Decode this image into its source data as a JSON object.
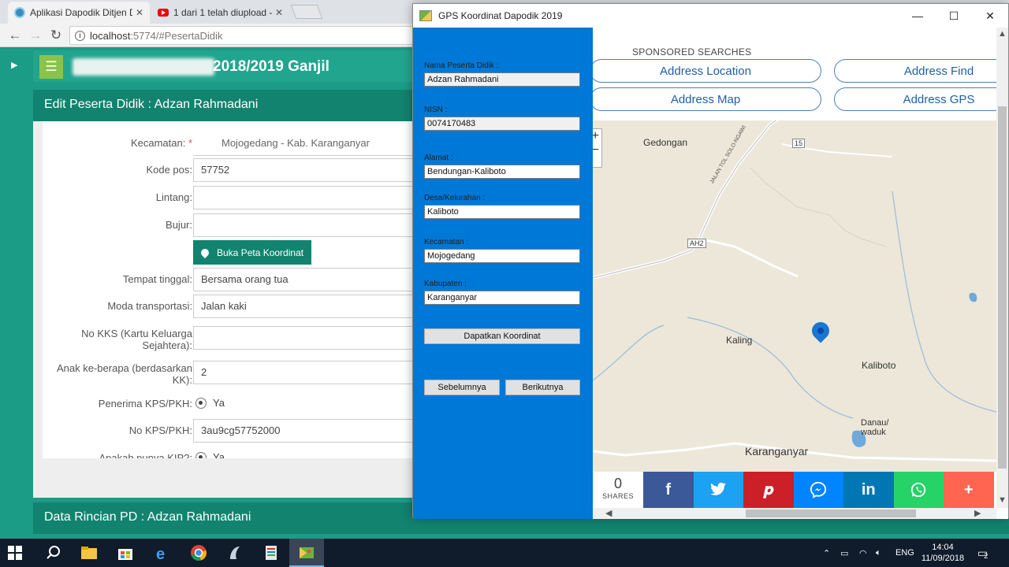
{
  "browser": {
    "tabs": [
      {
        "title": "Aplikasi Dapodik Ditjen D",
        "active": true
      },
      {
        "title": "1 dari 1 telah diupload - Y",
        "active": false
      }
    ],
    "url_host": "localhost",
    "url_rest": ":5774/#PesertaDidik"
  },
  "app": {
    "title_suffix": "2018/2019 Ganjil",
    "panel_title": "Edit Peserta Didik : Adzan Rahmadani",
    "panel2_title": "Data Rincian PD : Adzan Rahmadani"
  },
  "form": {
    "kecamatan_label": "Kecamatan:",
    "kecamatan_value": "Mojogedang - Kab. Karanganyar",
    "kodepos_label": "Kode pos:",
    "kodepos_value": "57752",
    "lintang_label": "Lintang:",
    "lintang_value": "",
    "bujur_label": "Bujur:",
    "bujur_value": "",
    "map_button": "Buka Peta Koordinat",
    "tempat_label": "Tempat tinggal:",
    "tempat_value": "Bersama orang tua",
    "moda_label": "Moda transportasi:",
    "moda_value": "Jalan kaki",
    "kks_label": "No KKS (Kartu Keluarga Sejahtera):",
    "kks_value": "",
    "anak_label": "Anak ke-berapa (berdasarkan KK):",
    "anak_value": "2",
    "kps_label": "Penerima KPS/PKH:",
    "kps_value": "Ya",
    "nokps_label": "No KPS/PKH:",
    "nokps_value": "3au9cg57752000",
    "kip_label": "Apakah punya KIP?:",
    "kip_value": "Ya"
  },
  "gps": {
    "window_title": "GPS Koordinat Dapodik 2019",
    "nama_label": "Nama Peserta Didik :",
    "nama_value": "Adzan Rahmadani",
    "nisn_label": "NISN :",
    "nisn_value": "0074170483",
    "alamat_label": "Alamat :",
    "alamat_value": "Bendungan-Kaliboto",
    "desa_label": "Desa/Kelurahan :",
    "desa_value": "Kaliboto",
    "kecamatan_label": "Kecamatan :",
    "kecamatan_value": "Mojogedang",
    "kabupaten_label": "Kabupaten :",
    "kabupaten_value": "Karanganyar",
    "get_button": "Dapatkan Koordinat",
    "prev_button": "Sebelumnya",
    "next_button": "Berikutnya",
    "sponsored": "SPONSORED SEARCHES",
    "ads": [
      "Address Location",
      "Address Find",
      "Address Map",
      "Address GPS"
    ],
    "map_labels": {
      "gedongan": "Gedongan",
      "kaling": "Kaling",
      "kaliboto": "Kaliboto",
      "danau": "Danau/",
      "waduk": "waduk",
      "karanganyar": "Karanganyar",
      "road_ah2": "AH2",
      "road_15": "15",
      "road_tol": "JALAN TOL SOLO-NGAWI"
    },
    "share_count": "0",
    "share_label": "SHARES",
    "share_colors": {
      "facebook": "#3b5998",
      "twitter": "#1da1f2",
      "pinterest": "#cb2027",
      "messenger": "#0084ff",
      "linkedin": "#0077b5",
      "whatsapp": "#25d366",
      "more": "#ff6550"
    }
  },
  "taskbar": {
    "lang": "ENG",
    "time": "14:04",
    "date": "11/09/2018",
    "notif_count": "2"
  }
}
